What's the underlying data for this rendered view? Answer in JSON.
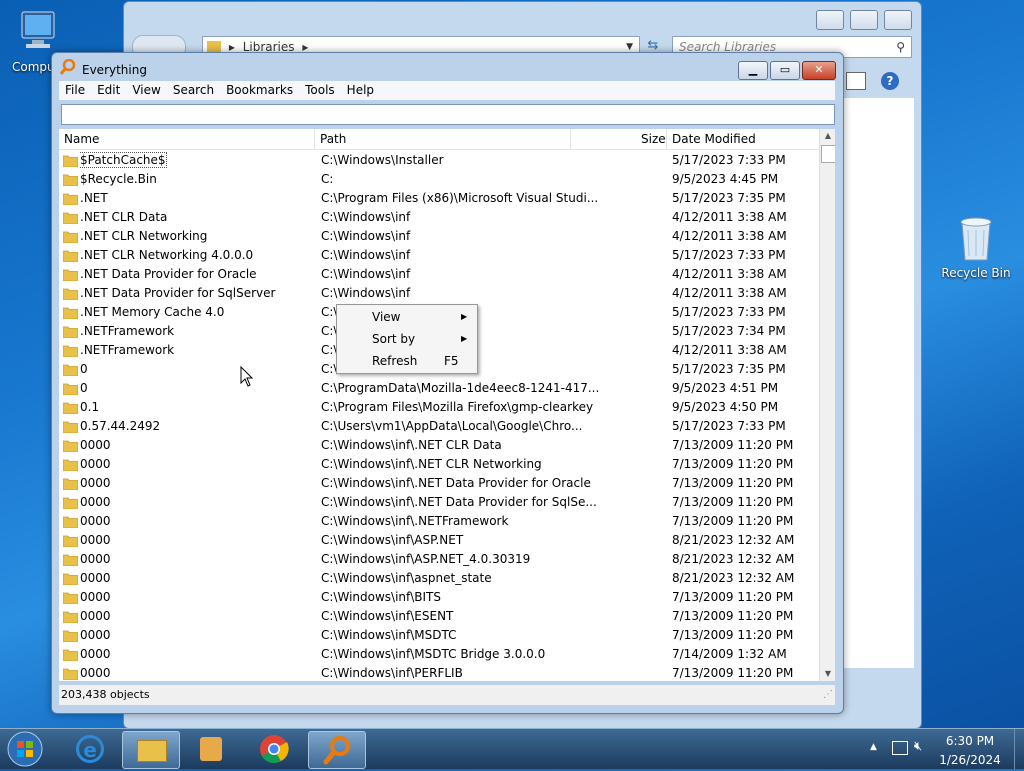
{
  "desktop": {
    "icons": [
      {
        "label": "Compu"
      },
      {
        "label": "Recycle Bin"
      }
    ]
  },
  "explorer": {
    "address": "Libraries",
    "search_placeholder": "Search Libraries"
  },
  "app": {
    "title": "Everything",
    "menu": [
      "File",
      "Edit",
      "View",
      "Search",
      "Bookmarks",
      "Tools",
      "Help"
    ],
    "search_value": "",
    "columns": {
      "name": "Name",
      "path": "Path",
      "size": "Size",
      "date": "Date Modified"
    },
    "rows": [
      {
        "name": "$PatchCache$",
        "path": "C:\\Windows\\Installer",
        "date": "5/17/2023 7:33 PM"
      },
      {
        "name": "$Recycle.Bin",
        "path": "C:",
        "date": "9/5/2023 4:45 PM"
      },
      {
        "name": ".NET",
        "path": "C:\\Program Files (x86)\\Microsoft Visual Studi...",
        "date": "5/17/2023 7:35 PM"
      },
      {
        "name": ".NET CLR Data",
        "path": "C:\\Windows\\inf",
        "date": "4/12/2011 3:38 AM"
      },
      {
        "name": ".NET CLR Networking",
        "path": "C:\\Windows\\inf",
        "date": "4/12/2011 3:38 AM"
      },
      {
        "name": ".NET CLR Networking 4.0.0.0",
        "path": "C:\\Windows\\inf",
        "date": "5/17/2023 7:33 PM"
      },
      {
        "name": ".NET Data Provider for Oracle",
        "path": "C:\\Windows\\inf",
        "date": "4/12/2011 3:38 AM"
      },
      {
        "name": ".NET Data Provider for SqlServer",
        "path": "C:\\Windows\\inf",
        "date": "4/12/2011 3:38 AM"
      },
      {
        "name": ".NET Memory Cache 4.0",
        "path": "C:\\",
        "date": "5/17/2023 7:33 PM"
      },
      {
        "name": ".NETFramework",
        "path": "C:\\",
        "date": "5/17/2023 7:34 PM"
      },
      {
        "name": ".NETFramework",
        "path": "C:\\",
        "date": "4/12/2011 3:38 AM"
      },
      {
        "name": "0",
        "path": "C:\\",
        "date": "5/17/2023 7:35 PM"
      },
      {
        "name": "0",
        "path": "C:\\ProgramData\\Mozilla-1de4eec8-1241-417...",
        "date": "9/5/2023 4:51 PM"
      },
      {
        "name": "0.1",
        "path": "C:\\Program Files\\Mozilla Firefox\\gmp-clearkey",
        "date": "9/5/2023 4:50 PM"
      },
      {
        "name": "0.57.44.2492",
        "path": "C:\\Users\\vm1\\AppData\\Local\\Google\\Chro...",
        "date": "5/17/2023 7:33 PM"
      },
      {
        "name": "0000",
        "path": "C:\\Windows\\inf\\.NET CLR Data",
        "date": "7/13/2009 11:20 PM"
      },
      {
        "name": "0000",
        "path": "C:\\Windows\\inf\\.NET CLR Networking",
        "date": "7/13/2009 11:20 PM"
      },
      {
        "name": "0000",
        "path": "C:\\Windows\\inf\\.NET Data Provider for Oracle",
        "date": "7/13/2009 11:20 PM"
      },
      {
        "name": "0000",
        "path": "C:\\Windows\\inf\\.NET Data Provider for SqlSe...",
        "date": "7/13/2009 11:20 PM"
      },
      {
        "name": "0000",
        "path": "C:\\Windows\\inf\\.NETFramework",
        "date": "7/13/2009 11:20 PM"
      },
      {
        "name": "0000",
        "path": "C:\\Windows\\inf\\ASP.NET",
        "date": "8/21/2023 12:32 AM"
      },
      {
        "name": "0000",
        "path": "C:\\Windows\\inf\\ASP.NET_4.0.30319",
        "date": "8/21/2023 12:32 AM"
      },
      {
        "name": "0000",
        "path": "C:\\Windows\\inf\\aspnet_state",
        "date": "8/21/2023 12:32 AM"
      },
      {
        "name": "0000",
        "path": "C:\\Windows\\inf\\BITS",
        "date": "7/13/2009 11:20 PM"
      },
      {
        "name": "0000",
        "path": "C:\\Windows\\inf\\ESENT",
        "date": "7/13/2009 11:20 PM"
      },
      {
        "name": "0000",
        "path": "C:\\Windows\\inf\\MSDTC",
        "date": "7/13/2009 11:20 PM"
      },
      {
        "name": "0000",
        "path": "C:\\Windows\\inf\\MSDTC Bridge 3.0.0.0",
        "date": "7/14/2009 1:32 AM"
      },
      {
        "name": "0000",
        "path": "C:\\Windows\\inf\\PERFLIB",
        "date": "7/13/2009 11:20 PM"
      }
    ],
    "status": "203,438 objects"
  },
  "context_menu": {
    "items": [
      {
        "label": "View",
        "shortcut": "",
        "submenu": true
      },
      {
        "label": "Sort by",
        "shortcut": "",
        "submenu": true
      },
      {
        "label": "Refresh",
        "shortcut": "F5",
        "submenu": false
      }
    ]
  },
  "taskbar": {
    "time": "6:30 PM",
    "date": "1/26/2024"
  },
  "colors": {
    "folder": "#e8c04a",
    "folder_dark": "#c99a1e",
    "accent": "#3e6a94"
  }
}
